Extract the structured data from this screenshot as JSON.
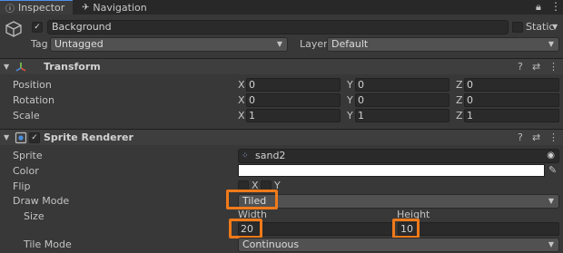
{
  "tabs": [
    {
      "label": "Inspector",
      "icon": "info-icon"
    },
    {
      "label": "Navigation",
      "icon": "navigation-icon"
    }
  ],
  "header": {
    "object_name": "Background",
    "static_label": "Static",
    "tag_label": "Tag",
    "tag_value": "Untagged",
    "layer_label": "Layer",
    "layer_value": "Default"
  },
  "transform": {
    "title": "Transform",
    "rows": [
      {
        "label": "Position",
        "x": "0",
        "y": "0",
        "z": "0"
      },
      {
        "label": "Rotation",
        "x": "0",
        "y": "0",
        "z": "0"
      },
      {
        "label": "Scale",
        "x": "1",
        "y": "1",
        "z": "1"
      }
    ],
    "axis_x": "X",
    "axis_y": "Y",
    "axis_z": "Z"
  },
  "sprite_renderer": {
    "title": "Sprite Renderer",
    "sprite_label": "Sprite",
    "sprite_value": "sand2",
    "color_label": "Color",
    "color_value": "#ffffff",
    "flip_label": "Flip",
    "flip_x": "X",
    "flip_y": "Y",
    "draw_mode_label": "Draw Mode",
    "draw_mode_value": "Tiled",
    "size_label": "Size",
    "width_label": "Width",
    "height_label": "Height",
    "width_value": "20",
    "height_value": "10",
    "tile_mode_label": "Tile Mode",
    "tile_mode_value": "Continuous"
  },
  "colors": {
    "highlight": "#ef7a1a",
    "background": "#383838"
  }
}
